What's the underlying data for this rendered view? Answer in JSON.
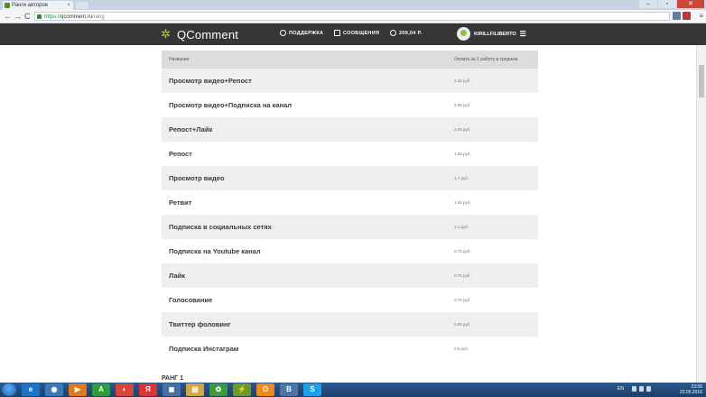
{
  "browser": {
    "tab_title": "Ранги авторов",
    "tab_close": "×",
    "window_buttons": [
      "–",
      "▫",
      "✕"
    ],
    "nav_back": "←",
    "nav_forward": "→",
    "nav_reload": "C",
    "url_scheme": "https://",
    "url_host": "qcomment.ru",
    "url_path": "/rang",
    "menu": "≡"
  },
  "site": {
    "logo_icon": "leaf-icon",
    "logo_text": "QComment",
    "nav": [
      {
        "label": "ПОДДЕРЖКА",
        "icon": "lifebuoy-icon"
      },
      {
        "label": "СООБЩЕНИЯ",
        "icon": "message-icon"
      },
      {
        "label": "209,04 Р.",
        "icon": "ruble-icon"
      }
    ],
    "username": "KIRILLFILIBERTO",
    "user_menu_icon": "☰"
  },
  "table": {
    "col_name": "Название",
    "col_price": "Оплата за 1 работу в среднем",
    "rows": [
      {
        "name": "Просмотр видео+Репост",
        "price": "3.45 руб."
      },
      {
        "name": "Просмотр видео+Подписка на канал",
        "price": "2.55 руб."
      },
      {
        "name": "Репост+Лайк",
        "price": "2.05 руб."
      },
      {
        "name": "Репост",
        "price": "1.85 руб."
      },
      {
        "name": "Просмотр видео",
        "price": "1.7 руб."
      },
      {
        "name": "Ретвит",
        "price": "1.55 руб."
      },
      {
        "name": "Подписка в социальных сетях",
        "price": "1.1 руб."
      },
      {
        "name": "Подписка на Youtube канал",
        "price": "0.75 руб."
      },
      {
        "name": "Лайк",
        "price": "0.75 руб."
      },
      {
        "name": "Голосование",
        "price": "0.75 руб."
      },
      {
        "name": "Твиттер фоловинг",
        "price": "0.55 руб."
      },
      {
        "name": "Подписка Инстаграм",
        "price": "0.5 руб."
      }
    ],
    "next_heading": "РАНГ 1"
  },
  "taskbar": {
    "apps": [
      {
        "glyph": "e",
        "color": "#1e73c8"
      },
      {
        "glyph": "◉",
        "color": "#3a7ab8"
      },
      {
        "glyph": "▶",
        "color": "#e07a1f"
      },
      {
        "glyph": "A",
        "color": "#2f9c3a"
      },
      {
        "glyph": "◐",
        "color": "#d6453b"
      },
      {
        "glyph": "Я",
        "color": "#d33"
      },
      {
        "glyph": "◼",
        "color": "#4a6fa5"
      },
      {
        "glyph": "▤",
        "color": "#d9a441"
      },
      {
        "glyph": "✿",
        "color": "#3c9a3c"
      },
      {
        "glyph": "⚡",
        "color": "#6c9a2c"
      },
      {
        "glyph": "О",
        "color": "#f08a1c"
      },
      {
        "glyph": "В",
        "color": "#4a76a8"
      },
      {
        "glyph": "S",
        "color": "#1da1e8"
      }
    ],
    "lang": "EN",
    "time": "23:55",
    "date": "22.05.2016"
  },
  "colors": {
    "header_bg": "#363636",
    "logo_accent": "#b8d23a",
    "row_alt": "#efefef",
    "thead_bg": "#dcdcdc"
  }
}
